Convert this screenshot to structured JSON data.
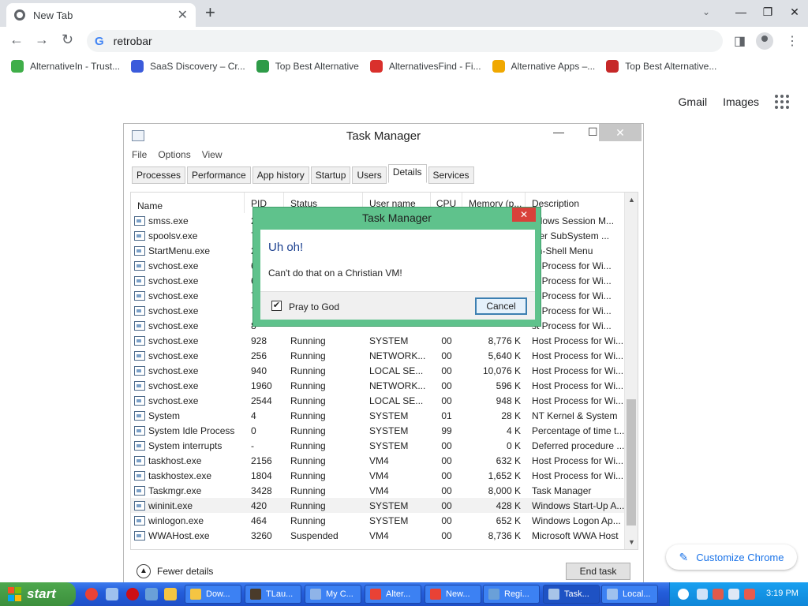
{
  "browser": {
    "tab_title": "New Tab",
    "omnibox_text": "retrobar",
    "bookmarks": [
      {
        "label": "AlternativeIn - Trust...",
        "color": "#3fae49"
      },
      {
        "label": "SaaS Discovery – Cr...",
        "color": "#3b5bdb"
      },
      {
        "label": "Top Best Alternative",
        "color": "#2e9b48"
      },
      {
        "label": "AlternativesFind - Fi...",
        "color": "#d9302c"
      },
      {
        "label": "Alternative Apps –...",
        "color": "#f0a800"
      },
      {
        "label": "Top Best Alternative...",
        "color": "#c62828"
      }
    ],
    "gmail": "Gmail",
    "images": "Images",
    "customize": "Customize Chrome"
  },
  "taskmgr": {
    "title": "Task Manager",
    "menu": [
      "File",
      "Options",
      "View"
    ],
    "tabs": [
      "Processes",
      "Performance",
      "App history",
      "Startup",
      "Users",
      "Details",
      "Services"
    ],
    "active_tab": "Details",
    "columns": [
      "Name",
      "PID",
      "Status",
      "User name",
      "CPU",
      "Memory (p...",
      "Description"
    ],
    "rows": [
      [
        "smss.exe",
        "2",
        "",
        "",
        "",
        "",
        "ndows Session M..."
      ],
      [
        "spoolsv.exe",
        "7",
        "",
        "",
        "",
        "",
        "oler SubSystem ..."
      ],
      [
        "StartMenu.exe",
        "2",
        "",
        "",
        "",
        "",
        "en-Shell Menu"
      ],
      [
        "svchost.exe",
        "6",
        "",
        "",
        "",
        "",
        "st Process for Wi..."
      ],
      [
        "svchost.exe",
        "6",
        "",
        "",
        "",
        "",
        "st Process for Wi..."
      ],
      [
        "svchost.exe",
        "7",
        "",
        "",
        "",
        "",
        "st Process for Wi..."
      ],
      [
        "svchost.exe",
        "7",
        "",
        "",
        "",
        "",
        "st Process for Wi..."
      ],
      [
        "svchost.exe",
        "8",
        "",
        "",
        "",
        "",
        "st Process for Wi..."
      ],
      [
        "svchost.exe",
        "928",
        "Running",
        "SYSTEM",
        "00",
        "8,776 K",
        "Host Process for Wi..."
      ],
      [
        "svchost.exe",
        "256",
        "Running",
        "NETWORK...",
        "00",
        "5,640 K",
        "Host Process for Wi..."
      ],
      [
        "svchost.exe",
        "940",
        "Running",
        "LOCAL SE...",
        "00",
        "10,076 K",
        "Host Process for Wi..."
      ],
      [
        "svchost.exe",
        "1960",
        "Running",
        "NETWORK...",
        "00",
        "596 K",
        "Host Process for Wi..."
      ],
      [
        "svchost.exe",
        "2544",
        "Running",
        "LOCAL SE...",
        "00",
        "948 K",
        "Host Process for Wi..."
      ],
      [
        "System",
        "4",
        "Running",
        "SYSTEM",
        "01",
        "28 K",
        "NT Kernel & System"
      ],
      [
        "System Idle Process",
        "0",
        "Running",
        "SYSTEM",
        "99",
        "4 K",
        "Percentage of time t..."
      ],
      [
        "System interrupts",
        "-",
        "Running",
        "SYSTEM",
        "00",
        "0 K",
        "Deferred procedure ..."
      ],
      [
        "taskhost.exe",
        "2156",
        "Running",
        "VM4",
        "00",
        "632 K",
        "Host Process for Wi..."
      ],
      [
        "taskhostex.exe",
        "1804",
        "Running",
        "VM4",
        "00",
        "1,652 K",
        "Host Process for Wi..."
      ],
      [
        "Taskmgr.exe",
        "3428",
        "Running",
        "VM4",
        "00",
        "8,000 K",
        "Task Manager"
      ],
      [
        "wininit.exe",
        "420",
        "Running",
        "SYSTEM",
        "00",
        "428 K",
        "Windows Start-Up A..."
      ],
      [
        "winlogon.exe",
        "464",
        "Running",
        "SYSTEM",
        "00",
        "652 K",
        "Windows Logon Ap..."
      ],
      [
        "WWAHost.exe",
        "3260",
        "Suspended",
        "VM4",
        "00",
        "8,736 K",
        "Microsoft WWA Host"
      ]
    ],
    "selected_row": 19,
    "fewer_details": "Fewer details",
    "end_task": "End task"
  },
  "dialog": {
    "title": "Task Manager",
    "heading": "Uh oh!",
    "message": "Can't do that on a Christian VM!",
    "checkbox_label": "Pray to God",
    "checkbox_checked": true,
    "cancel": "Cancel"
  },
  "taskbar": {
    "start": "start",
    "buttons": [
      {
        "label": "Dow...",
        "color": "#f5c542"
      },
      {
        "label": "TLau...",
        "color": "#4a3b2a"
      },
      {
        "label": "My C...",
        "color": "#8fb4e8"
      },
      {
        "label": "Alter...",
        "color": "#e94235"
      },
      {
        "label": "New...",
        "color": "#e94235"
      },
      {
        "label": "Regi...",
        "color": "#6aa0d8"
      },
      {
        "label": "Task...",
        "color": "#a8c4e8"
      },
      {
        "label": "Local...",
        "color": "#9fc1ee"
      }
    ],
    "clock": "3:19 PM"
  }
}
